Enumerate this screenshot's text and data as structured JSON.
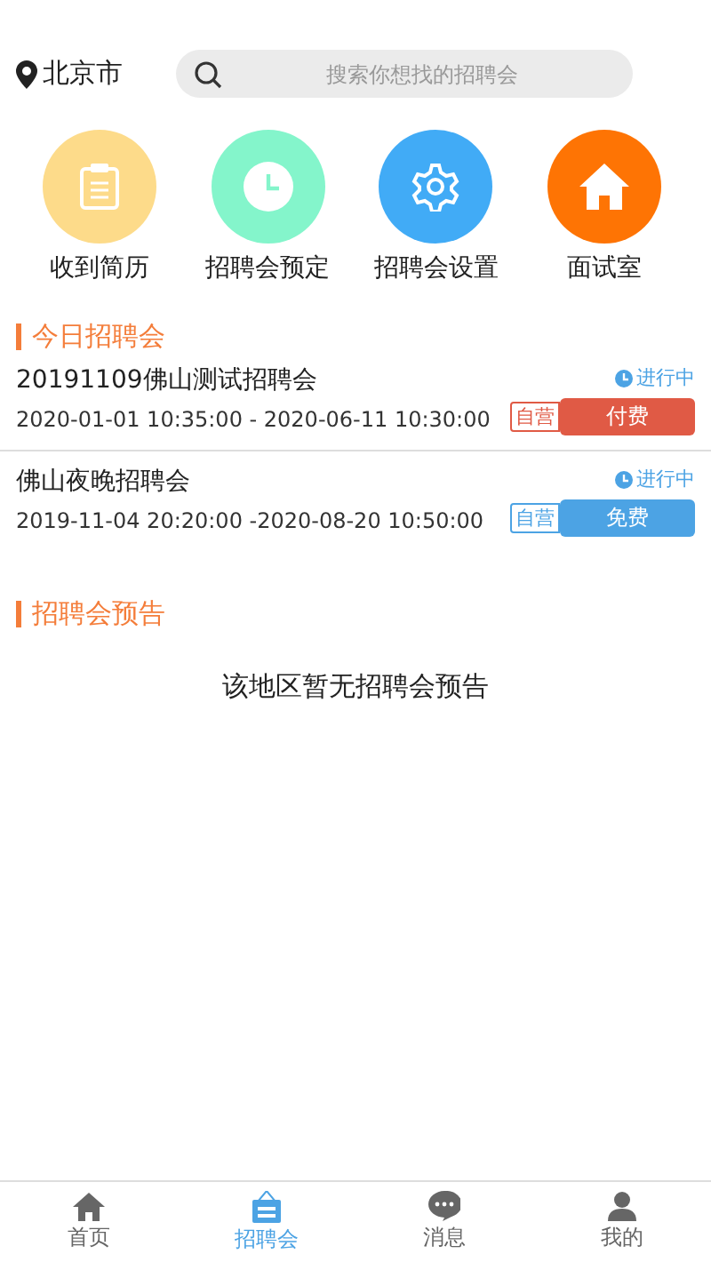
{
  "location": "北京市",
  "search": {
    "placeholder": "搜索你想找的招聘会"
  },
  "shortcuts": [
    {
      "label": "收到简历",
      "kind": "clipboard",
      "color": "#fddb8a"
    },
    {
      "label": "招聘会预定",
      "kind": "clock",
      "color": "#84f5cb"
    },
    {
      "label": "招聘会设置",
      "kind": "gear",
      "color": "#41abf6"
    },
    {
      "label": "面试室",
      "kind": "home",
      "color": "#fe7404"
    }
  ],
  "today": {
    "title": "今日招聘会",
    "fairs": [
      {
        "name": "20191109佛山测试招聘会",
        "time": "2020-01-01 10:35:00 - 2020-06-11 10:30:00",
        "status": "进行中",
        "tag": "自营",
        "fee": "付费",
        "kind": "paid"
      },
      {
        "name": "佛山夜晚招聘会",
        "time": "2019-11-04 20:20:00 -2020-08-20 10:50:00",
        "status": "进行中",
        "tag": "自营",
        "fee": "免费",
        "kind": "free"
      }
    ]
  },
  "preview": {
    "title": "招聘会预告",
    "empty": "该地区暂无招聘会预告"
  },
  "nav": [
    {
      "label": "首页",
      "kind": "home",
      "selected": false
    },
    {
      "label": "招聘会",
      "kind": "job",
      "selected": true
    },
    {
      "label": "消息",
      "kind": "chat",
      "selected": false
    },
    {
      "label": "我的",
      "kind": "person",
      "selected": false
    }
  ]
}
